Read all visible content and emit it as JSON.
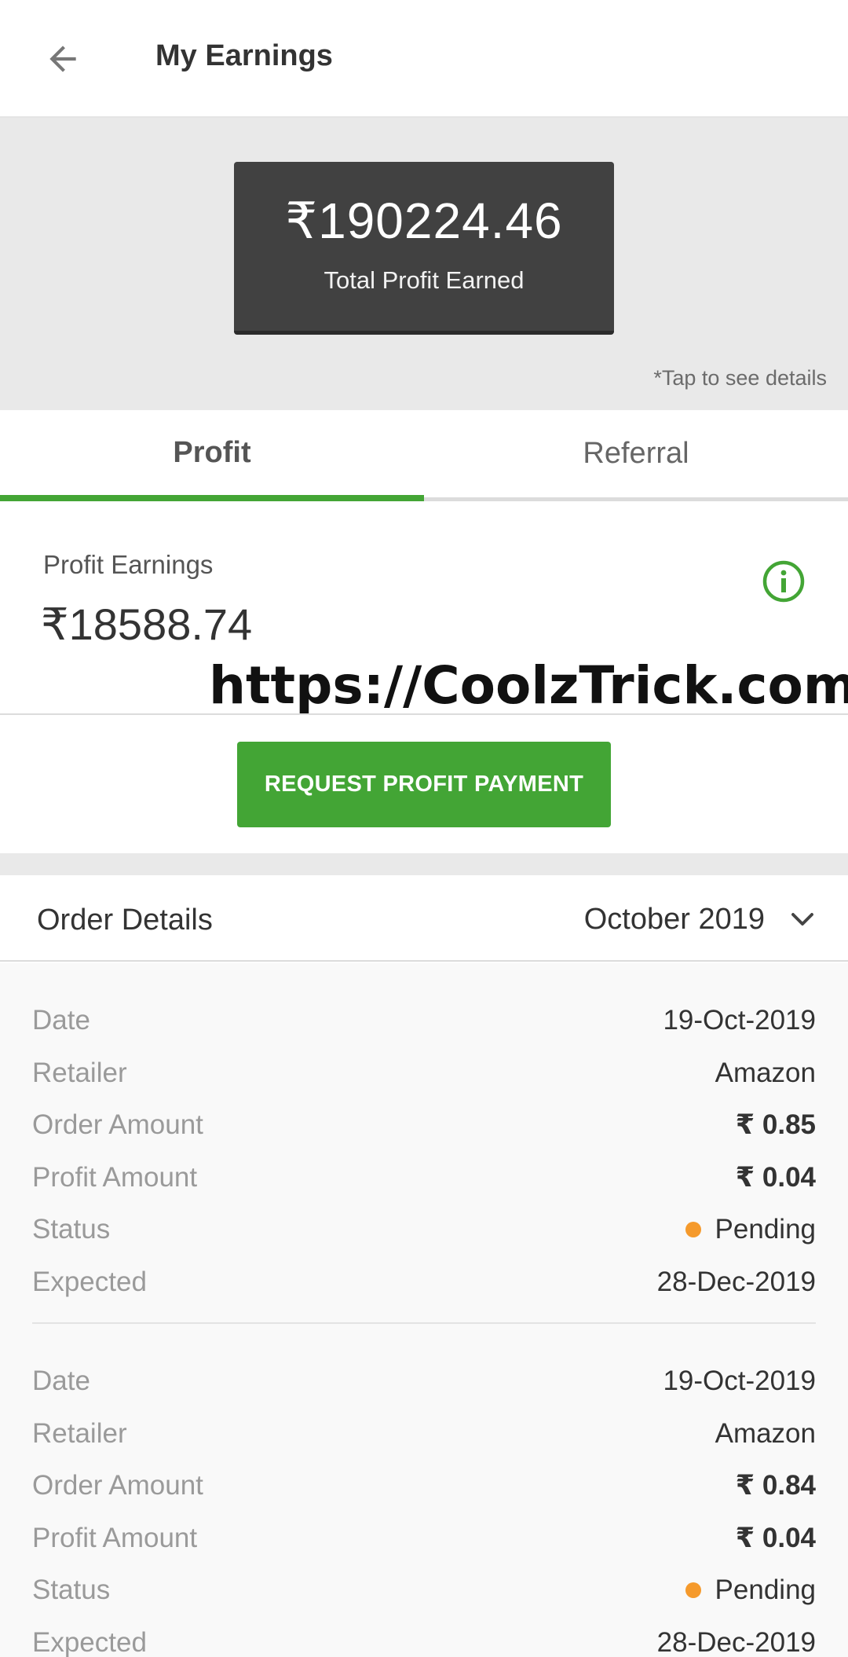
{
  "header": {
    "title": "My Earnings",
    "back_icon": "arrow-left-icon"
  },
  "summary": {
    "total_amount": "₹190224.46",
    "total_label": "Total Profit Earned",
    "hint": "*Tap to see details"
  },
  "tabs": [
    {
      "label": "Profit",
      "active": true
    },
    {
      "label": "Referral",
      "active": false
    }
  ],
  "profit": {
    "label": "Profit Earnings",
    "amount": "₹18588.74",
    "info_icon": "info-icon"
  },
  "watermark": "https://CoolzTrick.com",
  "request_button": "REQUEST PROFIT PAYMENT",
  "order_details": {
    "title": "Order Details",
    "month": "October 2019",
    "chevron_icon": "chevron-down-icon"
  },
  "row_labels": {
    "date": "Date",
    "retailer": "Retailer",
    "order_amount": "Order Amount",
    "profit_amount": "Profit Amount",
    "status": "Status",
    "expected": "Expected"
  },
  "orders": [
    {
      "date": "19-Oct-2019",
      "retailer": "Amazon",
      "order_amount": "₹ 0.85",
      "profit_amount": "₹ 0.04",
      "status": "Pending",
      "expected": "28-Dec-2019"
    },
    {
      "date": "19-Oct-2019",
      "retailer": "Amazon",
      "order_amount": "₹ 0.84",
      "profit_amount": "₹ 0.04",
      "status": "Pending",
      "expected": "28-Dec-2019"
    }
  ],
  "colors": {
    "accent": "#43a535",
    "card": "#414141",
    "pending": "#f59a2c"
  }
}
